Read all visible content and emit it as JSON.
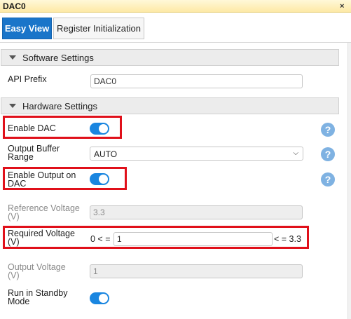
{
  "window": {
    "title": "DAC0",
    "close_glyph": "×"
  },
  "tabs": [
    {
      "label": "Easy View",
      "active": true
    },
    {
      "label": "Register Initialization",
      "active": false
    }
  ],
  "sections": {
    "software": "Software Settings",
    "hardware": "Hardware Settings"
  },
  "fields": {
    "api_prefix": {
      "label": "API Prefix",
      "value": "DAC0"
    },
    "enable_dac": {
      "label": "Enable DAC",
      "on": true
    },
    "output_buffer_range": {
      "label_line1": "Output Buffer",
      "label_line2": "Range",
      "value": "AUTO"
    },
    "enable_output": {
      "label_line1": "Enable Output on",
      "label_line2": "DAC",
      "on": true
    },
    "reference_voltage": {
      "label_line1": "Reference Voltage",
      "label_line2": "(V)",
      "value": "3.3"
    },
    "required_voltage": {
      "label_line1": "Required Voltage",
      "label_line2": "(V)",
      "prefix": "0 < =",
      "value": "1",
      "suffix": "< = 3.3"
    },
    "output_voltage": {
      "label_line1": "Output Voltage",
      "label_line2": "(V)",
      "value": "1"
    },
    "run_in_standby": {
      "label_line1": "Run in Standby",
      "label_line2": "Mode",
      "on": true
    }
  },
  "help_glyph": "?",
  "colors": {
    "accent": "#1a75c9",
    "toggle_on": "#1a86e0",
    "highlight": "#e0101a",
    "help": "#7fb2e2"
  }
}
